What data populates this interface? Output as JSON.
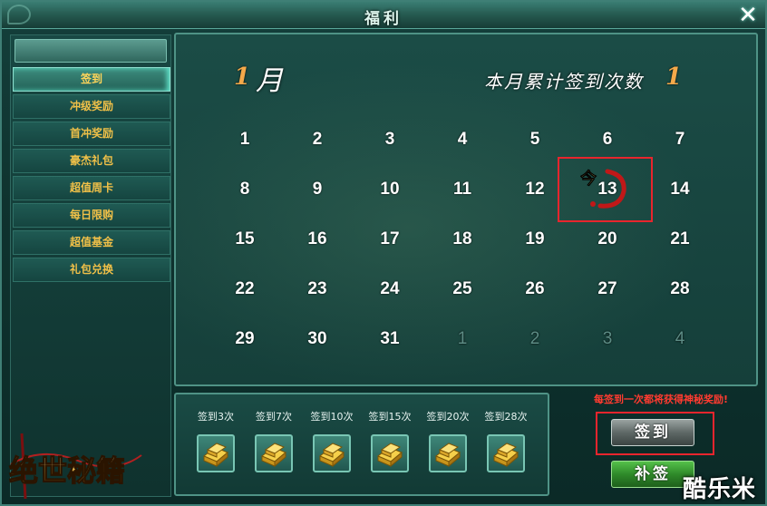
{
  "window": {
    "title": "福利",
    "close_icon": "close-icon"
  },
  "sidebar": {
    "items": [
      {
        "label": "签到",
        "active": true
      },
      {
        "label": "冲级奖励",
        "active": false
      },
      {
        "label": "首冲奖励",
        "active": false
      },
      {
        "label": "豪杰礼包",
        "active": false
      },
      {
        "label": "超值周卡",
        "active": false
      },
      {
        "label": "每日限购",
        "active": false
      },
      {
        "label": "超值基金",
        "active": false
      },
      {
        "label": "礼包兑换",
        "active": false
      }
    ]
  },
  "calendar": {
    "month_number": "1",
    "month_char": "月",
    "count_label": "本月累计签到次数",
    "count_value": "1",
    "today": "13",
    "today_mark": "今",
    "days": [
      "1",
      "2",
      "3",
      "4",
      "5",
      "6",
      "7",
      "8",
      "9",
      "10",
      "11",
      "12",
      "13",
      "14",
      "15",
      "16",
      "17",
      "18",
      "19",
      "20",
      "21",
      "22",
      "23",
      "24",
      "25",
      "26",
      "27",
      "28",
      "29",
      "30",
      "31",
      "1",
      "2",
      "3",
      "4"
    ]
  },
  "rewards": [
    {
      "label": "签到3次",
      "icon": "gold-ingot-icon"
    },
    {
      "label": "签到7次",
      "icon": "gold-ingot-icon"
    },
    {
      "label": "签到10次",
      "icon": "gold-ingot-icon"
    },
    {
      "label": "签到15次",
      "icon": "gold-ingot-icon"
    },
    {
      "label": "签到20次",
      "icon": "gold-ingot-icon"
    },
    {
      "label": "签到28次",
      "icon": "gold-ingot-icon"
    }
  ],
  "actions": {
    "notice": "每签到一次都将获得神秘奖励!",
    "sign_label": "签到",
    "makeup_label": "补签"
  },
  "logo_text": "绝世秘籍",
  "watermark": "酷乐米",
  "colors": {
    "accent": "#f0c048",
    "highlight": "#e8252d",
    "panel": "#153f3a"
  }
}
